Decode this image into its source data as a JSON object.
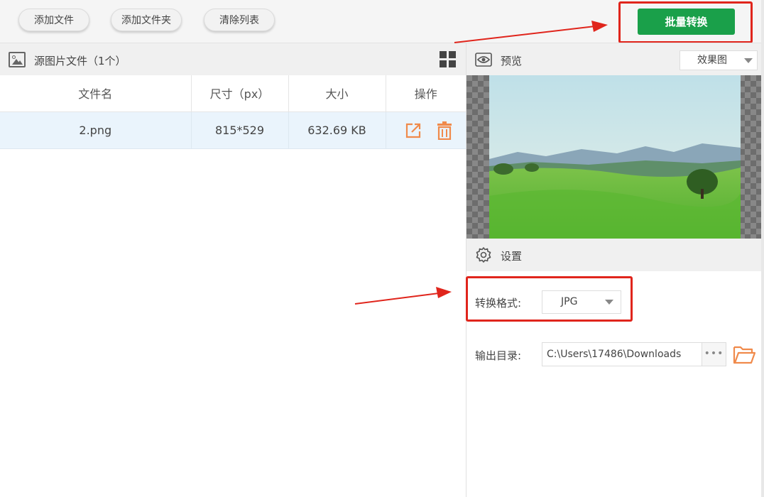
{
  "toolbar": {
    "add_file": "添加文件",
    "add_folder": "添加文件夹",
    "clear_list": "清除列表",
    "batch_convert": "批量转换"
  },
  "left_panel": {
    "title": "源图片文件（1个）",
    "columns": {
      "name": "文件名",
      "size": "尺寸（px）",
      "bytes": "大小",
      "ops": "操作"
    },
    "rows": [
      {
        "name": "2.png",
        "size": "815*529",
        "bytes": "632.69 KB"
      }
    ]
  },
  "preview": {
    "title": "预览",
    "mode": "效果图"
  },
  "settings": {
    "title": "设置",
    "format_label": "转换格式:",
    "format_value": "JPG",
    "output_label": "输出目录:",
    "output_path": "C:\\Users\\17486\\Downloads",
    "browse_label": "•••"
  },
  "colors": {
    "accent_green": "#1aa04a",
    "highlight_red": "#e0251c",
    "icon_orange": "#f08a4b"
  }
}
